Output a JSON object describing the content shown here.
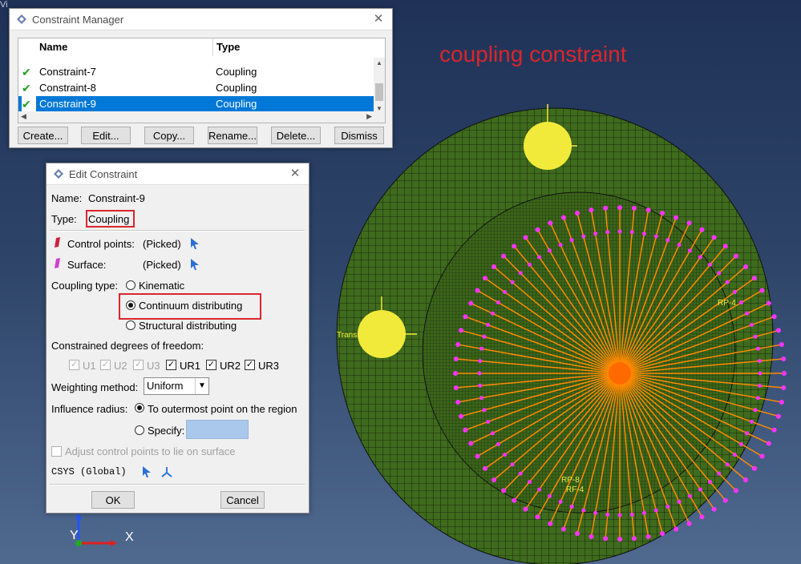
{
  "overlay": {
    "title": "coupling constraint",
    "app_title_fragment": "Vi"
  },
  "triad": {
    "x": "X",
    "y": "Y"
  },
  "viewport_labels": {
    "transition": "Transiti",
    "rp4": "RP-4",
    "rp8": "RP-8",
    "rf4": "RF-4"
  },
  "constraint_manager": {
    "title": "Constraint Manager",
    "columns": {
      "name": "Name",
      "type": "Type"
    },
    "rows": [
      {
        "name": "Constraint-7",
        "type": "Coupling",
        "checked": true
      },
      {
        "name": "Constraint-8",
        "type": "Coupling",
        "checked": true
      },
      {
        "name": "Constraint-9",
        "type": "Coupling",
        "checked": true,
        "selected": true
      }
    ],
    "buttons": {
      "create": "Create...",
      "edit": "Edit...",
      "copy": "Copy...",
      "rename": "Rename...",
      "delete": "Delete...",
      "dismiss": "Dismiss"
    }
  },
  "edit_constraint": {
    "title": "Edit Constraint",
    "name_label": "Name:",
    "name_value": "Constraint-9",
    "type_label": "Type:",
    "type_value": "Coupling",
    "control_points_label": "Control points:",
    "control_points_value": "(Picked)",
    "surface_label": "Surface:",
    "surface_value": "(Picked)",
    "coupling_type_label": "Coupling type:",
    "coupling_options": [
      "Kinematic",
      "Continuum distributing",
      "Structural distributing"
    ],
    "coupling_selected": "Continuum distributing",
    "dof_label": "Constrained degrees of freedom:",
    "dofs": [
      {
        "label": "U1",
        "checked": true,
        "enabled": false
      },
      {
        "label": "U2",
        "checked": true,
        "enabled": false
      },
      {
        "label": "U3",
        "checked": true,
        "enabled": false
      },
      {
        "label": "UR1",
        "checked": true,
        "enabled": true
      },
      {
        "label": "UR2",
        "checked": true,
        "enabled": true
      },
      {
        "label": "UR3",
        "checked": true,
        "enabled": true
      }
    ],
    "weighting_label": "Weighting method:",
    "weighting_value": "Uniform",
    "influence_label": "Influence radius:",
    "influence_outer": "To outermost point on the region",
    "influence_specify": "Specify:",
    "adjust_label": "Adjust control points to lie on surface",
    "csys_label": "CSYS (Global)",
    "ok": "OK",
    "cancel": "Cancel"
  },
  "colors": {
    "accent": "#0078d7",
    "highlight": "#d9262c",
    "mesh": "#3e6b1c",
    "ring": "#ff33ff",
    "spokes": "#ff8a00"
  }
}
